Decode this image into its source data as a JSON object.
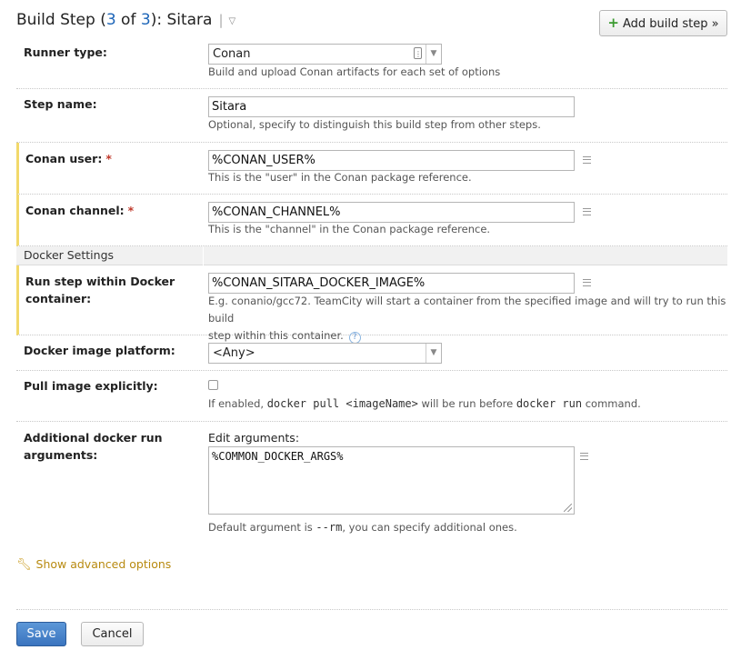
{
  "header": {
    "title_prefix": "Build Step (",
    "step_current": "3",
    "of_word": " of ",
    "step_total": "3",
    "title_suffix": "): Sitara",
    "caret": "▽",
    "separator": "|",
    "add_step_label": "Add build step »",
    "add_step_icon": "+"
  },
  "runner": {
    "label": "Runner type:",
    "value": "Conan",
    "hint": "Build and upload Conan artifacts for each set of options"
  },
  "step_name": {
    "label": "Step name:",
    "value": "Sitara",
    "hint": "Optional, specify to distinguish this build step from other steps."
  },
  "conan_user": {
    "label": "Conan user:",
    "required_mark": "*",
    "value": "%CONAN_USER%",
    "hint": "This is the \"user\" in the Conan package reference."
  },
  "conan_channel": {
    "label": "Conan channel:",
    "required_mark": "*",
    "value": "%CONAN_CHANNEL%",
    "hint": "This is the \"channel\" in the Conan package reference."
  },
  "docker_section": {
    "title": "Docker Settings"
  },
  "docker_container": {
    "label_line1": "Run step within Docker",
    "label_line2": "container:",
    "value": "%CONAN_SITARA_DOCKER_IMAGE%",
    "hint_line1": "E.g. conanio/gcc72. TeamCity will start a container from the specified image and will try to run this build",
    "hint_line2": "step within this container.",
    "help_icon": "?"
  },
  "docker_platform": {
    "label": "Docker image platform:",
    "value": "<Any>"
  },
  "pull_image": {
    "label": "Pull image explicitly:",
    "checked": false,
    "hint_pre": "If enabled, ",
    "hint_code1": "docker pull <imageName>",
    "hint_mid": " will be run before ",
    "hint_code2": "docker run",
    "hint_post": " command."
  },
  "docker_args": {
    "label_line1": "Additional docker run",
    "label_line2": "arguments:",
    "edit_label": "Edit arguments:",
    "value": "%COMMON_DOCKER_ARGS%",
    "hint_pre": "Default argument is ",
    "hint_code": "--rm",
    "hint_post": ", you can specify additional ones."
  },
  "advanced": {
    "label": "Show advanced options",
    "icon": "wrench-icon"
  },
  "footer": {
    "save_label": "Save",
    "cancel_label": "Cancel"
  },
  "colors": {
    "accent": "#1d65b8",
    "required_bar": "#f2d96b",
    "link_gold": "#b88a10",
    "save_blue": "#3a74bf"
  }
}
